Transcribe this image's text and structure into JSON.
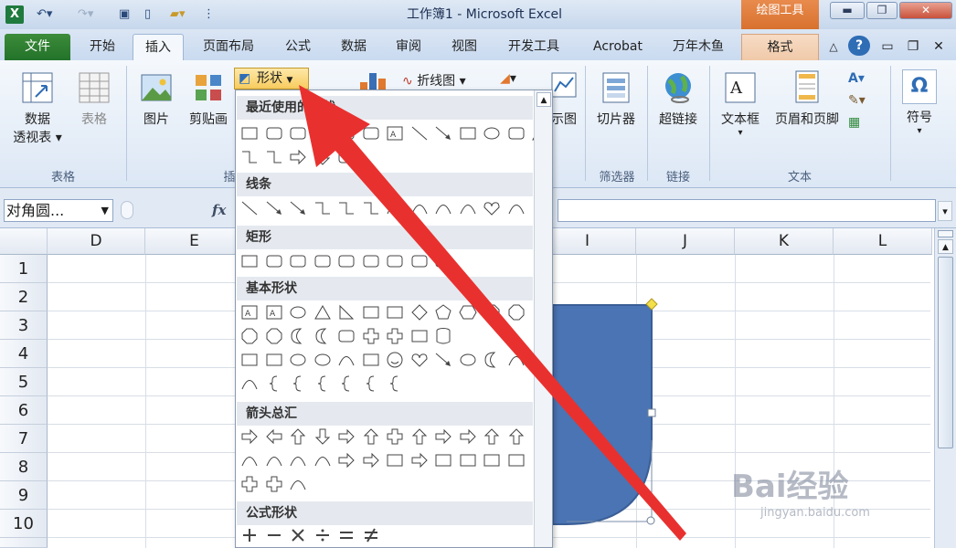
{
  "window": {
    "title": "工作簿1 - Microsoft Excel",
    "context_tools": "绘图工具",
    "colors": {
      "accent": "#2f6db5",
      "file_tab": "#2e7d32",
      "context": "#e0793b",
      "shape_fill": "#4a74b3",
      "arrow": "#e8312f"
    }
  },
  "tabs": [
    "文件",
    "开始",
    "插入",
    "页面布局",
    "公式",
    "数据",
    "审阅",
    "视图",
    "开发工具",
    "Acrobat",
    "万年木鱼",
    "格式"
  ],
  "ribbon": {
    "pivot_line1": "数据",
    "pivot_line2": "透视表",
    "table": "表格",
    "group_tables": "表格",
    "picture": "图片",
    "clipart": "剪贴画",
    "group_illustrations": "插",
    "shapes": "形状",
    "line_chart": "折线图",
    "sparkline_partial": "示图",
    "slicer": "切片器",
    "group_filter": "筛选器",
    "hyperlink": "超链接",
    "group_links": "链接",
    "textbox": "文本框",
    "header_footer": "页眉和页脚",
    "group_text": "文本",
    "symbol": "符号"
  },
  "formula_bar": {
    "name_box": "对角圆...",
    "fx": "fx"
  },
  "columns": [
    "D",
    "E",
    "I",
    "J",
    "K",
    "L"
  ],
  "rows": [
    "1",
    "2",
    "3",
    "4",
    "5",
    "6",
    "7",
    "8",
    "9",
    "10"
  ],
  "gallery": {
    "recent_title": "最近使用的形状",
    "lines_title": "线条",
    "rect_title": "矩形",
    "basic_title": "基本形状",
    "arrows_title": "箭头总汇",
    "equation_title": "公式形状",
    "basic_labels": [
      "10",
      "12"
    ]
  },
  "watermark": {
    "brand": "Bai经验",
    "url": "jingyan.baidu.com"
  }
}
